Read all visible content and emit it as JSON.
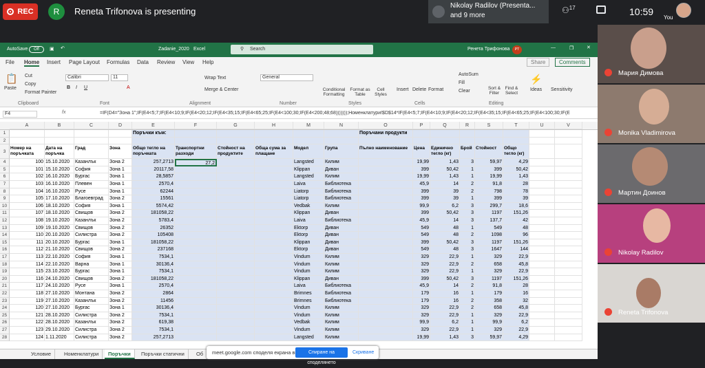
{
  "meet": {
    "rec_label": "REC",
    "presenter_initial": "R",
    "presenting_text": "Reneta Trifonova is presenting",
    "participants_info_line1": "Nikolay Radilov (Presenta...",
    "participants_info_line2": "and 9 more",
    "people_count": "17",
    "time": "10:59",
    "you_label": "You",
    "share_bar_text": "meet.google.com споделя екрана ви.",
    "stop_sharing_label": "Спиране на споделянето",
    "hide_label": "Скриване"
  },
  "tiles": [
    "Мария Димова",
    "Monika Vladimirova",
    "Мартин Доинов",
    "Nikolay Radilov",
    "Reneta Trifonova"
  ],
  "excel": {
    "autosave": "AutoSave",
    "autosave_state": "Off",
    "filename": "Zadanie_2020",
    "app": "Excel",
    "search_placeholder": "Search",
    "user": "Ренета Трифонова",
    "user_initials": "РТ",
    "tabs": [
      "File",
      "Home",
      "Insert",
      "Page Layout",
      "Formulas",
      "Data",
      "Review",
      "View",
      "Help"
    ],
    "share": "Share",
    "comments": "Comments",
    "ribbon": {
      "paste": "Paste",
      "cut": "Cut",
      "copy": "Copy",
      "format_painter": "Format Painter",
      "clipboard": "Clipboard",
      "font_name": "Calibri",
      "font_size": "11",
      "font": "Font",
      "wrap_text": "Wrap Text",
      "merge_center": "Merge & Center",
      "alignment": "Alignment",
      "number_format": "General",
      "number": "Number",
      "conditional": "Conditional Formatting",
      "format_table": "Format as Table",
      "cell_styles": "Cell Styles",
      "styles": "Styles",
      "insert": "Insert",
      "delete": "Delete",
      "format": "Format",
      "cells": "Cells",
      "autosum": "AutoSum",
      "fill": "Fill",
      "clear": "Clear",
      "sort": "Sort & Filter",
      "find": "Find & Select",
      "editing": "Editing",
      "ideas": "Ideas",
      "sensitivity": "Sensitivity"
    },
    "name_box": "F4",
    "formula": "=IF(D4=\"Зона 1\";IF(E4<5;7;IF(E4<10;9;IF(E4<20;12;IF(E4<35;15;IF(E4<65;25;IF(E4<100;30;IF(E4<200;48;68)))))));Номенклатури!$D$14*IF(E4<5;7;IF(E4<10;9;IF(E4<20;12;IF(E4<35;15;IF(E4<65;25;IF(E4<100;30;IF(E",
    "columns": [
      "A",
      "B",
      "C",
      "D",
      "E",
      "F",
      "G",
      "H",
      "M",
      "N",
      "O",
      "P",
      "Q",
      "R",
      "S",
      "T",
      "U",
      "V"
    ],
    "row1": {
      "E": "Поръчки към:",
      "O": "Поръчани продукти"
    },
    "headers": {
      "A": "Номер на поръчката",
      "B": "Дата на поръчка",
      "C": "Град",
      "D": "Зона",
      "E": "Общо тегло на поръчката",
      "F": "Транспортни разходи",
      "G": "Стойност на продуктите",
      "H": "Обща сума за плащане",
      "M": "Модел",
      "N": "Група",
      "O": "Пълно наименование",
      "P": "Цена",
      "Q": "Единично тегло (кг)",
      "R": "Брой",
      "S": "Стойност",
      "T": "Общо тегло (кг)"
    },
    "f4_value": "27,2",
    "rows": [
      [
        "4",
        "100",
        "15.10.2020",
        "Казанлък",
        "Зона 2",
        "257,2713",
        "Langsted",
        "Килим",
        "19,99",
        "1,43",
        "3",
        "59,97",
        "4,29"
      ],
      [
        "5",
        "101",
        "15.10.2020",
        "София",
        "Зона 1",
        "20117,58",
        "Klippan",
        "Диван",
        "399",
        "50,42",
        "1",
        "399",
        "50,42"
      ],
      [
        "6",
        "102",
        "16.10.2020",
        "Бургас",
        "Зона 1",
        "28,5857",
        "Langsted",
        "Килим",
        "19,99",
        "1,43",
        "1",
        "19,99",
        "1,43"
      ],
      [
        "7",
        "103",
        "16.10.2020",
        "Плевен",
        "Зона 1",
        "2570,4",
        "Laiva",
        "Библиотека",
        "45,9",
        "14",
        "2",
        "91,8",
        "28"
      ],
      [
        "8",
        "104",
        "16.10.2020",
        "Русе",
        "Зона 1",
        "62244",
        "Liatorp",
        "Библиотека",
        "399",
        "39",
        "2",
        "798",
        "78"
      ],
      [
        "9",
        "105",
        "17.10.2020",
        "Благоевград",
        "Зона 2",
        "15561",
        "Liatorp",
        "Библиотека",
        "399",
        "39",
        "1",
        "399",
        "39"
      ],
      [
        "10",
        "106",
        "18.10.2020",
        "София",
        "Зона 1",
        "5574,42",
        "Vedbak",
        "Килим",
        "99,9",
        "6,2",
        "3",
        "299,7",
        "18,6"
      ],
      [
        "11",
        "107",
        "18.10.2020",
        "Свищов",
        "Зона 2",
        "181058,22",
        "Klippan",
        "Диван",
        "399",
        "50,42",
        "3",
        "1197",
        "151,26"
      ],
      [
        "12",
        "108",
        "19.10.2020",
        "Казанлък",
        "Зона 2",
        "5783,4",
        "Laiva",
        "Библиотека",
        "45,9",
        "14",
        "3",
        "137,7",
        "42"
      ],
      [
        "13",
        "109",
        "19.10.2020",
        "Свищов",
        "Зона 2",
        "26352",
        "Ektorp",
        "Диван",
        "549",
        "48",
        "1",
        "549",
        "48"
      ],
      [
        "14",
        "110",
        "20.10.2020",
        "Силистра",
        "Зона 2",
        "105408",
        "Ektorp",
        "Диван",
        "549",
        "48",
        "2",
        "1098",
        "96"
      ],
      [
        "15",
        "111",
        "20.10.2020",
        "Бургас",
        "Зона 1",
        "181058,22",
        "Klippan",
        "Диван",
        "399",
        "50,42",
        "3",
        "1197",
        "151,26"
      ],
      [
        "16",
        "112",
        "21.10.2020",
        "Свищов",
        "Зона 2",
        "237168",
        "Ektorp",
        "Диван",
        "549",
        "48",
        "3",
        "1647",
        "144"
      ],
      [
        "17",
        "113",
        "22.10.2020",
        "София",
        "Зона 1",
        "7534,1",
        "Vindum",
        "Килим",
        "329",
        "22,9",
        "1",
        "329",
        "22,9"
      ],
      [
        "18",
        "114",
        "22.10.2020",
        "Варна",
        "Зона 1",
        "30136,4",
        "Vindum",
        "Килим",
        "329",
        "22,9",
        "2",
        "658",
        "45,8"
      ],
      [
        "19",
        "115",
        "23.10.2020",
        "Бургас",
        "Зона 1",
        "7534,1",
        "Vindum",
        "Килим",
        "329",
        "22,9",
        "1",
        "329",
        "22,9"
      ],
      [
        "20",
        "116",
        "24.10.2020",
        "Свищов",
        "Зона 2",
        "181058,22",
        "Klippan",
        "Диван",
        "399",
        "50,42",
        "3",
        "1197",
        "151,26"
      ],
      [
        "21",
        "117",
        "24.10.2020",
        "Русе",
        "Зона 1",
        "2570,4",
        "Laiva",
        "Библиотека",
        "45,9",
        "14",
        "2",
        "91,8",
        "28"
      ],
      [
        "22",
        "118",
        "27.10.2020",
        "Монтана",
        "Зона 2",
        "2864",
        "Brimnes",
        "Библиотека",
        "179",
        "16",
        "1",
        "179",
        "16"
      ],
      [
        "23",
        "119",
        "27.10.2020",
        "Казанлък",
        "Зона 2",
        "11456",
        "Brimnes",
        "Библиотека",
        "179",
        "16",
        "2",
        "358",
        "32"
      ],
      [
        "24",
        "120",
        "27.10.2020",
        "Бургас",
        "Зона 1",
        "30136,4",
        "Vindum",
        "Килим",
        "329",
        "22,9",
        "2",
        "658",
        "45,8"
      ],
      [
        "25",
        "121",
        "28.10.2020",
        "Силистра",
        "Зона 2",
        "7534,1",
        "Vindum",
        "Килим",
        "329",
        "22,9",
        "1",
        "329",
        "22,9"
      ],
      [
        "26",
        "122",
        "28.10.2020",
        "Казанлък",
        "Зона 2",
        "619,38",
        "Vedbak",
        "Килим",
        "99,9",
        "6,2",
        "1",
        "99,9",
        "6,2"
      ],
      [
        "27",
        "123",
        "29.10.2020",
        "Силистра",
        "Зона 2",
        "7534,1",
        "Vindum",
        "Килим",
        "329",
        "22,9",
        "1",
        "329",
        "22,9"
      ],
      [
        "28",
        "124",
        "1.11.2020",
        "Силистра",
        "Зона 2",
        "257,2713",
        "Langsted",
        "Килим",
        "19,99",
        "1,43",
        "3",
        "59,97",
        "4,29"
      ]
    ],
    "sheet_tabs": [
      "Условие",
      "Номенклатури",
      "Поръчки",
      "Поръчки статични",
      "Об"
    ]
  }
}
